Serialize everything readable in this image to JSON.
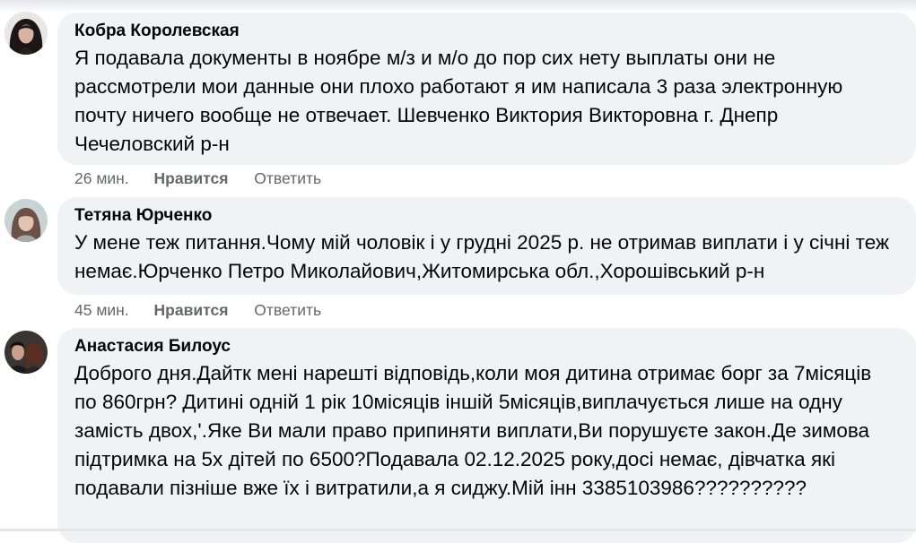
{
  "comments": [
    {
      "author": "Кобра Королевская",
      "text": "Я подавала документы в ноябре м/з и м/о до пор сих нету выплаты они не рассмотрели мои данные они плохо работают я им написала 3 раза электронную почту ничего вообще не отвечает. Шевченко Виктория Викторовна г. Днепр Чечеловский р-н",
      "time": "26 мин.",
      "like_label": "Нравится",
      "reply_label": "Ответить"
    },
    {
      "author": "Тетяна Юрченко",
      "text": "У мене теж питання.Чому мій чоловік і у грудні 2025 р. не отримав виплати і у січні теж немає.Юрченко Петро Миколайович,Житомирська обл.,Хорошівський р-н",
      "time": "45 мин.",
      "like_label": "Нравится",
      "reply_label": "Ответить"
    },
    {
      "author": "Анастасия Билоус",
      "text": "Доброго дня.Дайтк мені нарешті відповідь,коли моя дитина отримає борг за 7місяців по 860грн? Дитині одній 1 рік 10місяців іншій 5місяців,виплачується лише на одну замість двох,'.Яке Ви мали право припиняти виплати,Ви порушуєте закон.Де зимова підтримка на 5х дітей по 6500?Подавала 02.12.2025 року,досі немає, дівчатка які подавали пізніше вже їх і витратили,а я сиджу.Мій інн 3385103986??????????"
    }
  ]
}
